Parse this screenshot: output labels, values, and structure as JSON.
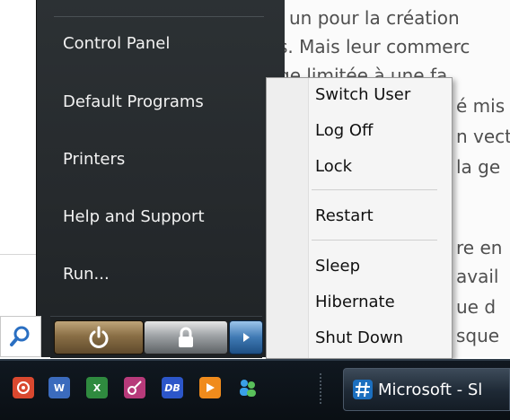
{
  "document": {
    "lines": [
      "un pour la création",
      "s. Mais leur commerc",
      "ge limitée à une fa",
      "é mis",
      "n vect",
      "la ge",
      "re en",
      "avail",
      "ue d",
      "sque"
    ]
  },
  "start_menu": {
    "items": [
      "Control Panel",
      "Default Programs",
      "Printers",
      "Help and Support",
      "Run..."
    ]
  },
  "power_bar": {
    "power_icon": "power-icon",
    "lock_icon": "lock-icon",
    "arrow_icon": "arrow-right-icon"
  },
  "search": {
    "icon": "search-icon"
  },
  "shutdown_menu": {
    "items": [
      "Switch User",
      "Log Off",
      "Lock",
      "Restart",
      "Sleep",
      "Hibernate",
      "Shut Down"
    ]
  },
  "taskbar": {
    "icons": [
      "media-icon",
      "word-icon",
      "excel-icon",
      "vpn-icon",
      "database-icon",
      "player-icon",
      "contacts-icon"
    ],
    "task_button": {
      "label": "Microsoft - Sl",
      "icon": "hash-icon"
    }
  },
  "colors": {
    "start_panel": "#2a2f32",
    "power_button": "#8a6f46",
    "arrow_button": "#3f79b3",
    "popup_bg": "#f5f5f5",
    "taskbar": "#0d141a"
  }
}
